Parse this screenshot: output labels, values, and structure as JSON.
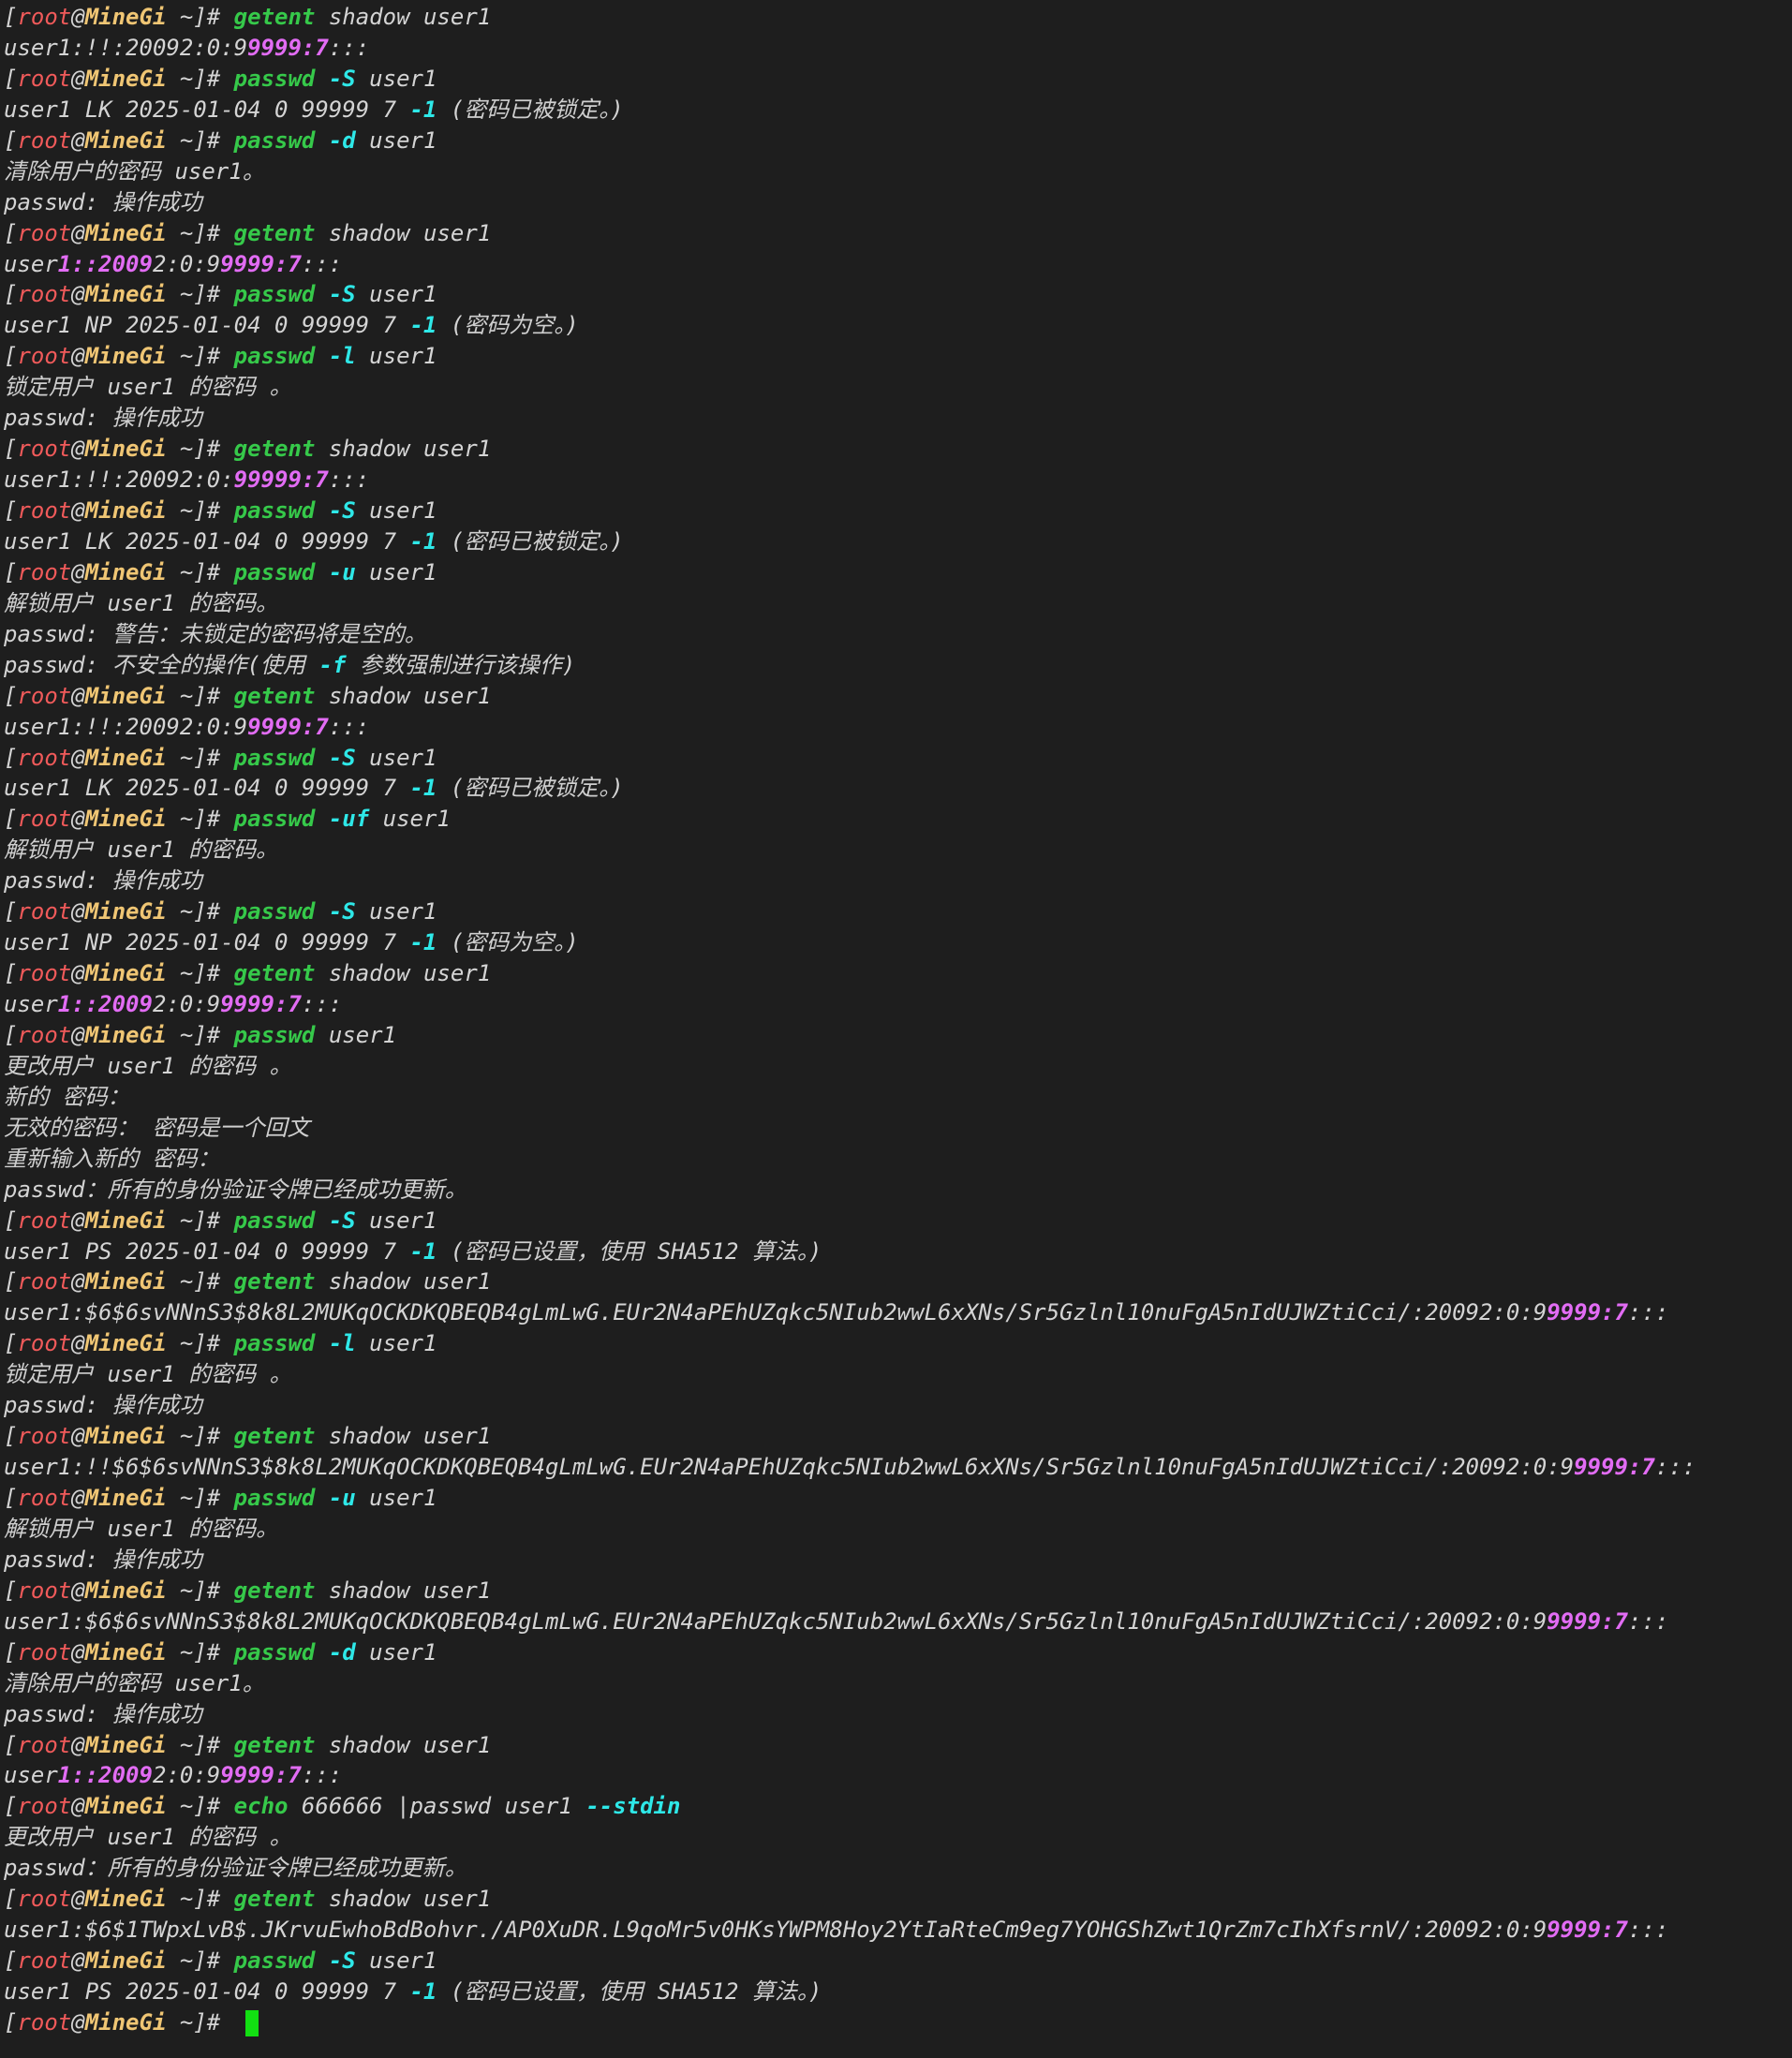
{
  "prompt": {
    "open": "[",
    "user": "root",
    "at": "@",
    "host": "MineGi",
    "path": " ~",
    "close": "]",
    "hash": "# "
  },
  "lines": [
    {
      "k": "cmd",
      "s": [
        [
          "cmd",
          "getent"
        ],
        [
          "plain",
          " shadow user1"
        ]
      ]
    },
    {
      "k": "out",
      "s": [
        [
          "plain",
          "user1:!!:20092:0:9"
        ],
        [
          "mag",
          "9999:7"
        ],
        [
          "plain",
          ":::"
        ]
      ]
    },
    {
      "k": "cmd",
      "s": [
        [
          "cmd",
          "passwd"
        ],
        [
          "plain",
          " "
        ],
        [
          "flag",
          "-S"
        ],
        [
          "plain",
          " user1"
        ]
      ]
    },
    {
      "k": "out",
      "s": [
        [
          "plain",
          "user1 LK 2025-01-04 0 99999 7 "
        ],
        [
          "num",
          "-1"
        ],
        [
          "plain",
          " ("
        ],
        [
          "cjk",
          "密码已被锁定。"
        ],
        [
          "plain",
          ")"
        ]
      ]
    },
    {
      "k": "cmd",
      "s": [
        [
          "cmd",
          "passwd"
        ],
        [
          "plain",
          " "
        ],
        [
          "flag",
          "-d"
        ],
        [
          "plain",
          " user1"
        ]
      ]
    },
    {
      "k": "out",
      "s": [
        [
          "cjk",
          "清除用户的密码"
        ],
        [
          "plain",
          " user1"
        ],
        [
          "cjk",
          "。"
        ]
      ]
    },
    {
      "k": "out",
      "s": [
        [
          "plain",
          "passwd: "
        ],
        [
          "cjk",
          "操作成功"
        ]
      ]
    },
    {
      "k": "cmd",
      "s": [
        [
          "cmd",
          "getent"
        ],
        [
          "plain",
          " shadow user1"
        ]
      ]
    },
    {
      "k": "out",
      "s": [
        [
          "plain",
          "user"
        ],
        [
          "mag",
          "1::2009"
        ],
        [
          "plain",
          "2:0:9"
        ],
        [
          "mag",
          "9999:7"
        ],
        [
          "plain",
          ":::"
        ]
      ]
    },
    {
      "k": "cmd",
      "s": [
        [
          "cmd",
          "passwd"
        ],
        [
          "plain",
          " "
        ],
        [
          "flag",
          "-S"
        ],
        [
          "plain",
          " user1"
        ]
      ]
    },
    {
      "k": "out",
      "s": [
        [
          "plain",
          "user1 NP 2025-01-04 0 99999 7 "
        ],
        [
          "num",
          "-1"
        ],
        [
          "plain",
          " ("
        ],
        [
          "cjk",
          "密码为空。"
        ],
        [
          "plain",
          ")"
        ]
      ]
    },
    {
      "k": "cmd",
      "s": [
        [
          "cmd",
          "passwd"
        ],
        [
          "plain",
          " "
        ],
        [
          "flag",
          "-l"
        ],
        [
          "plain",
          " user1"
        ]
      ]
    },
    {
      "k": "out",
      "s": [
        [
          "cjk",
          "锁定用户"
        ],
        [
          "plain",
          " user1 "
        ],
        [
          "cjk",
          "的密码"
        ],
        [
          "plain",
          " "
        ],
        [
          "cjk",
          "。"
        ]
      ]
    },
    {
      "k": "out",
      "s": [
        [
          "plain",
          "passwd: "
        ],
        [
          "cjk",
          "操作成功"
        ]
      ]
    },
    {
      "k": "cmd",
      "s": [
        [
          "cmd",
          "getent"
        ],
        [
          "plain",
          " shadow user1"
        ]
      ]
    },
    {
      "k": "out",
      "s": [
        [
          "plain",
          "user1:!!:20092:0:"
        ],
        [
          "mag",
          "99999:7"
        ],
        [
          "plain",
          ":::"
        ]
      ]
    },
    {
      "k": "cmd",
      "s": [
        [
          "cmd",
          "passwd"
        ],
        [
          "plain",
          " "
        ],
        [
          "flag",
          "-S"
        ],
        [
          "plain",
          " user1"
        ]
      ]
    },
    {
      "k": "out",
      "s": [
        [
          "plain",
          "user1 LK 2025-01-04 0 99999 7 "
        ],
        [
          "num",
          "-1"
        ],
        [
          "plain",
          " ("
        ],
        [
          "cjk",
          "密码已被锁定。"
        ],
        [
          "plain",
          ")"
        ]
      ]
    },
    {
      "k": "cmd",
      "s": [
        [
          "cmd",
          "passwd"
        ],
        [
          "plain",
          " "
        ],
        [
          "flag",
          "-u"
        ],
        [
          "plain",
          " user1"
        ]
      ]
    },
    {
      "k": "out",
      "s": [
        [
          "cjk",
          "解锁用户"
        ],
        [
          "plain",
          " user1 "
        ],
        [
          "cjk",
          "的密码。"
        ]
      ]
    },
    {
      "k": "out",
      "s": [
        [
          "plain",
          "passwd: "
        ],
        [
          "cjk",
          "警告：未锁定的密码将是空的。"
        ]
      ]
    },
    {
      "k": "out",
      "s": [
        [
          "plain",
          "passwd: "
        ],
        [
          "cjk",
          "不安全的操作"
        ],
        [
          "plain",
          "("
        ],
        [
          "cjk",
          "使用"
        ],
        [
          "plain",
          " "
        ],
        [
          "flag",
          "-f"
        ],
        [
          "plain",
          " "
        ],
        [
          "cjk",
          "参数强制进行该操作"
        ],
        [
          "plain",
          ")"
        ]
      ]
    },
    {
      "k": "cmd",
      "s": [
        [
          "cmd",
          "getent"
        ],
        [
          "plain",
          " shadow user1"
        ]
      ]
    },
    {
      "k": "out",
      "s": [
        [
          "plain",
          "user1:!!:20092:0:9"
        ],
        [
          "mag",
          "9999:7"
        ],
        [
          "plain",
          ":::"
        ]
      ]
    },
    {
      "k": "cmd",
      "s": [
        [
          "cmd",
          "passwd"
        ],
        [
          "plain",
          " "
        ],
        [
          "flag",
          "-S"
        ],
        [
          "plain",
          " user1"
        ]
      ]
    },
    {
      "k": "out",
      "s": [
        [
          "plain",
          "user1 LK 2025-01-04 0 99999 7 "
        ],
        [
          "num",
          "-1"
        ],
        [
          "plain",
          " ("
        ],
        [
          "cjk",
          "密码已被锁定。"
        ],
        [
          "plain",
          ")"
        ]
      ]
    },
    {
      "k": "cmd",
      "s": [
        [
          "cmd",
          "passwd"
        ],
        [
          "plain",
          " "
        ],
        [
          "flag",
          "-uf"
        ],
        [
          "plain",
          " user1"
        ]
      ]
    },
    {
      "k": "out",
      "s": [
        [
          "cjk",
          "解锁用户"
        ],
        [
          "plain",
          " user1 "
        ],
        [
          "cjk",
          "的密码。"
        ]
      ]
    },
    {
      "k": "out",
      "s": [
        [
          "plain",
          "passwd: "
        ],
        [
          "cjk",
          "操作成功"
        ]
      ]
    },
    {
      "k": "cmd",
      "s": [
        [
          "cmd",
          "passwd"
        ],
        [
          "plain",
          " "
        ],
        [
          "flag",
          "-S"
        ],
        [
          "plain",
          " user1"
        ]
      ]
    },
    {
      "k": "out",
      "s": [
        [
          "plain",
          "user1 NP 2025-01-04 0 99999 7 "
        ],
        [
          "num",
          "-1"
        ],
        [
          "plain",
          " ("
        ],
        [
          "cjk",
          "密码为空。"
        ],
        [
          "plain",
          ")"
        ]
      ]
    },
    {
      "k": "cmd",
      "s": [
        [
          "cmd",
          "getent"
        ],
        [
          "plain",
          " shadow user1"
        ]
      ]
    },
    {
      "k": "out",
      "s": [
        [
          "plain",
          "user"
        ],
        [
          "mag",
          "1::2009"
        ],
        [
          "plain",
          "2:0:9"
        ],
        [
          "mag",
          "9999:7"
        ],
        [
          "plain",
          ":::"
        ]
      ]
    },
    {
      "k": "cmd",
      "s": [
        [
          "cmd",
          "passwd"
        ],
        [
          "plain",
          " user1"
        ]
      ]
    },
    {
      "k": "out",
      "s": [
        [
          "cjk",
          "更改用户"
        ],
        [
          "plain",
          " user1 "
        ],
        [
          "cjk",
          "的密码"
        ],
        [
          "plain",
          " "
        ],
        [
          "cjk",
          "。"
        ]
      ]
    },
    {
      "k": "out",
      "s": [
        [
          "cjk",
          "新的"
        ],
        [
          "plain",
          " "
        ],
        [
          "cjk",
          "密码："
        ]
      ]
    },
    {
      "k": "out",
      "s": [
        [
          "cjk",
          "无效的密码："
        ],
        [
          "plain",
          " "
        ],
        [
          "cjk",
          "密码是一个回文"
        ]
      ]
    },
    {
      "k": "out",
      "s": [
        [
          "cjk",
          "重新输入新的"
        ],
        [
          "plain",
          " "
        ],
        [
          "cjk",
          "密码："
        ]
      ]
    },
    {
      "k": "out",
      "s": [
        [
          "plain",
          "passwd："
        ],
        [
          "cjk",
          "所有的身份验证令牌已经成功更新。"
        ]
      ]
    },
    {
      "k": "cmd",
      "s": [
        [
          "cmd",
          "passwd"
        ],
        [
          "plain",
          " "
        ],
        [
          "flag",
          "-S"
        ],
        [
          "plain",
          " user1"
        ]
      ]
    },
    {
      "k": "out",
      "s": [
        [
          "plain",
          "user1 PS 2025-01-04 0 99999 7 "
        ],
        [
          "num",
          "-1"
        ],
        [
          "plain",
          " ("
        ],
        [
          "cjk",
          "密码已设置，使用"
        ],
        [
          "plain",
          " SHA512 "
        ],
        [
          "cjk",
          "算法。"
        ],
        [
          "plain",
          ")"
        ]
      ]
    },
    {
      "k": "cmd",
      "s": [
        [
          "cmd",
          "getent"
        ],
        [
          "plain",
          " shadow user1"
        ]
      ]
    },
    {
      "k": "out",
      "s": [
        [
          "plain",
          "user1:$6$6svNNnS3$8k8L2MUKqOCKDKQBEQB4gLmLwG.EUr2N4aPEhUZqkc5NIub2wwL6xXNs/Sr5Gzlnl10nuFgA5nIdUJWZtiCci/:20092:0:9"
        ],
        [
          "mag",
          "9999:7"
        ],
        [
          "plain",
          ":::"
        ]
      ]
    },
    {
      "k": "cmd",
      "s": [
        [
          "cmd",
          "passwd"
        ],
        [
          "plain",
          " "
        ],
        [
          "flag",
          "-l"
        ],
        [
          "plain",
          " user1"
        ]
      ]
    },
    {
      "k": "out",
      "s": [
        [
          "cjk",
          "锁定用户"
        ],
        [
          "plain",
          " user1 "
        ],
        [
          "cjk",
          "的密码"
        ],
        [
          "plain",
          " "
        ],
        [
          "cjk",
          "。"
        ]
      ]
    },
    {
      "k": "out",
      "s": [
        [
          "plain",
          "passwd: "
        ],
        [
          "cjk",
          "操作成功"
        ]
      ]
    },
    {
      "k": "cmd",
      "s": [
        [
          "cmd",
          "getent"
        ],
        [
          "plain",
          " shadow user1"
        ]
      ]
    },
    {
      "k": "out",
      "s": [
        [
          "plain",
          "user1:!!$6$6svNNnS3$8k8L2MUKqOCKDKQBEQB4gLmLwG.EUr2N4aPEhUZqkc5NIub2wwL6xXNs/Sr5Gzlnl10nuFgA5nIdUJWZtiCci/:20092:0:9"
        ],
        [
          "mag",
          "9999:7"
        ],
        [
          "plain",
          ":::"
        ]
      ]
    },
    {
      "k": "cmd",
      "s": [
        [
          "cmd",
          "passwd"
        ],
        [
          "plain",
          " "
        ],
        [
          "flag",
          "-u"
        ],
        [
          "plain",
          " user1"
        ]
      ]
    },
    {
      "k": "out",
      "s": [
        [
          "cjk",
          "解锁用户"
        ],
        [
          "plain",
          " user1 "
        ],
        [
          "cjk",
          "的密码。"
        ]
      ]
    },
    {
      "k": "out",
      "s": [
        [
          "plain",
          "passwd: "
        ],
        [
          "cjk",
          "操作成功"
        ]
      ]
    },
    {
      "k": "cmd",
      "s": [
        [
          "cmd",
          "getent"
        ],
        [
          "plain",
          " shadow user1"
        ]
      ]
    },
    {
      "k": "out",
      "s": [
        [
          "plain",
          "user1:$6$6svNNnS3$8k8L2MUKqOCKDKQBEQB4gLmLwG.EUr2N4aPEhUZqkc5NIub2wwL6xXNs/Sr5Gzlnl10nuFgA5nIdUJWZtiCci/:20092:0:9"
        ],
        [
          "mag",
          "9999:7"
        ],
        [
          "plain",
          ":::"
        ]
      ]
    },
    {
      "k": "cmd",
      "s": [
        [
          "cmd",
          "passwd"
        ],
        [
          "plain",
          " "
        ],
        [
          "flag",
          "-d"
        ],
        [
          "plain",
          " user1"
        ]
      ]
    },
    {
      "k": "out",
      "s": [
        [
          "cjk",
          "清除用户的密码"
        ],
        [
          "plain",
          " user1"
        ],
        [
          "cjk",
          "。"
        ]
      ]
    },
    {
      "k": "out",
      "s": [
        [
          "plain",
          "passwd: "
        ],
        [
          "cjk",
          "操作成功"
        ]
      ]
    },
    {
      "k": "cmd",
      "s": [
        [
          "cmd",
          "getent"
        ],
        [
          "plain",
          " shadow user1"
        ]
      ]
    },
    {
      "k": "out",
      "s": [
        [
          "plain",
          "user"
        ],
        [
          "mag",
          "1::2009"
        ],
        [
          "plain",
          "2:0:9"
        ],
        [
          "mag",
          "9999:7"
        ],
        [
          "plain",
          ":::"
        ]
      ]
    },
    {
      "k": "cmd",
      "s": [
        [
          "cmd",
          "echo"
        ],
        [
          "plain",
          " 666666 |passwd user1 "
        ],
        [
          "flag",
          "--stdin"
        ]
      ]
    },
    {
      "k": "out",
      "s": [
        [
          "cjk",
          "更改用户"
        ],
        [
          "plain",
          " user1 "
        ],
        [
          "cjk",
          "的密码"
        ],
        [
          "plain",
          " "
        ],
        [
          "cjk",
          "。"
        ]
      ]
    },
    {
      "k": "out",
      "s": [
        [
          "plain",
          "passwd："
        ],
        [
          "cjk",
          "所有的身份验证令牌已经成功更新。"
        ]
      ]
    },
    {
      "k": "cmd",
      "s": [
        [
          "cmd",
          "getent"
        ],
        [
          "plain",
          " shadow user1"
        ]
      ]
    },
    {
      "k": "out",
      "s": [
        [
          "plain",
          "user1:$6$1TWpxLvB$.JKrvuEwhoBdBohvr./AP0XuDR.L9qoMr5v0HKsYWPM8Hoy2YtIaRteCm9eg7YOHGShZwt1QrZm7cIhXfsrnV/:20092:0:9"
        ],
        [
          "mag",
          "9999:7"
        ],
        [
          "plain",
          ":::"
        ]
      ]
    },
    {
      "k": "cmd",
      "s": [
        [
          "cmd",
          "passwd"
        ],
        [
          "plain",
          " "
        ],
        [
          "flag",
          "-S"
        ],
        [
          "plain",
          " user1"
        ]
      ]
    },
    {
      "k": "out",
      "s": [
        [
          "plain",
          "user1 PS 2025-01-04 0 99999 7 "
        ],
        [
          "num",
          "-1"
        ],
        [
          "plain",
          " ("
        ],
        [
          "cjk",
          "密码已设置，使用"
        ],
        [
          "plain",
          " SHA512 "
        ],
        [
          "cjk",
          "算法。"
        ],
        [
          "plain",
          ")"
        ]
      ]
    },
    {
      "k": "prompt",
      "s": []
    }
  ],
  "colors": {
    "background": "#1e1e1e",
    "text": "#d4d4d4",
    "prompt_user": "#f05a5a",
    "prompt_host": "#f0c674",
    "command": "#36c94a",
    "flag": "#2ee8e8",
    "highlight": "#e26cf4",
    "cursor": "#12e012"
  }
}
